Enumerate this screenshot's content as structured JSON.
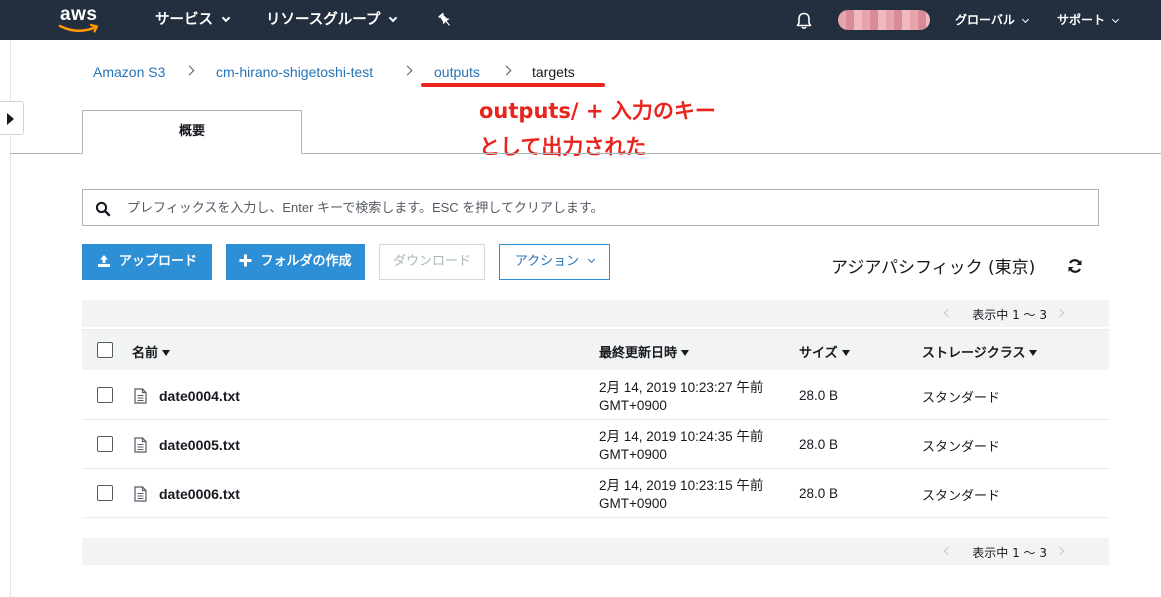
{
  "nav": {
    "logo": "aws",
    "services_label": "サービス",
    "resource_groups_label": "リソースグループ",
    "region_label": "グローバル",
    "support_label": "サポート",
    "icons": [
      "pin-icon",
      "bell-icon"
    ]
  },
  "breadcrumb": {
    "items": [
      "Amazon S3",
      "cm-hirano-shigetoshi-test",
      "outputs",
      "targets"
    ]
  },
  "annotation": {
    "line1": "outputs/ + 入力のキー",
    "line2": "として出力された",
    "color": "#e8241c"
  },
  "tabs": {
    "overview_label": "概要"
  },
  "search": {
    "placeholder": "プレフィックスを入力し、Enter キーで検索します。ESC を押してクリアします。",
    "value": ""
  },
  "actions": {
    "upload_label": "アップロード",
    "create_folder_label": "フォルダの作成",
    "download_label": "ダウンロード",
    "action_label": "アクション"
  },
  "region": {
    "label": "アジアパシフィック (東京)"
  },
  "pager": {
    "label": "表示中 1 〜 3"
  },
  "table": {
    "columns": [
      "名前",
      "最終更新日時",
      "サイズ",
      "ストレージクラス"
    ],
    "rows": [
      {
        "name": "date0004.txt",
        "date_line1": "2月 14, 2019 10:23:27 午前",
        "date_line2": "GMT+0900",
        "size": "28.0 B",
        "storage_class": "スタンダード"
      },
      {
        "name": "date0005.txt",
        "date_line1": "2月 14, 2019 10:24:35 午前",
        "date_line2": "GMT+0900",
        "size": "28.0 B",
        "storage_class": "スタンダード"
      },
      {
        "name": "date0006.txt",
        "date_line1": "2月 14, 2019 10:23:15 午前",
        "date_line2": "GMT+0900",
        "size": "28.0 B",
        "storage_class": "スタンダード"
      }
    ]
  },
  "colors": {
    "nav_bg": "#232f3e",
    "primary_button": "#2d8fd5",
    "link": "#2773b8",
    "annotation_red": "#e8241c"
  }
}
